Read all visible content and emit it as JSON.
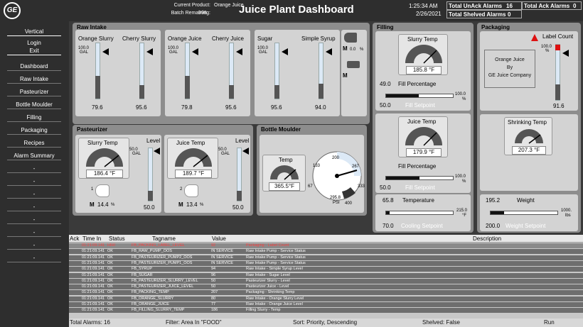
{
  "header": {
    "product_label": "Current Product:",
    "product_value": "Orange Juice",
    "batch_label": "Batch Remaining:",
    "batch_value": "998",
    "title": "Juice Plant Dashboard",
    "time": "1:25:34 AM",
    "date": "2/26/2021",
    "unack_label": "Total UnAck Alarms",
    "unack_value": "16",
    "ack_label": "Total Ack Alarms",
    "ack_value": "0",
    "shelved_label": "Total Shelved Alarms",
    "shelved_value": "0"
  },
  "sidebar": {
    "vertical": "Vertical",
    "login": "Login",
    "exit": "Exit",
    "items": [
      "Dashboard",
      "Raw Intake",
      "Pasteurizer",
      "Bottle Moulder",
      "Filling",
      "Packaging",
      "Recipes",
      "Alarm Summary",
      "-",
      "-",
      "-",
      "-",
      "-",
      "-",
      "-",
      "-"
    ]
  },
  "raw_intake": {
    "title": "Raw Intake",
    "tanks": [
      {
        "name": "Orange Slurry",
        "scale": "100.0",
        "unit": "GAL",
        "value": "79.6",
        "level": 0.8
      },
      {
        "name": "Cherry Slurry",
        "scale": "",
        "unit": "",
        "value": "95.6",
        "level": 0.96
      },
      {
        "name": "Orange Juice",
        "scale": "100.0",
        "unit": "GAL",
        "value": "79.8",
        "level": 0.8
      },
      {
        "name": "Cherry Juice",
        "scale": "",
        "unit": "",
        "value": "95.6",
        "level": 0.96
      },
      {
        "name": "Sugar",
        "scale": "100.0",
        "unit": "GAL",
        "value": "95.6",
        "level": 0.96
      },
      {
        "name": "Simple Syrup",
        "scale": "",
        "unit": "",
        "value": "94.0",
        "level": 0.94
      }
    ],
    "pump1": {
      "mode": "M",
      "value": "0.0",
      "unit": "%"
    },
    "pump2": {
      "mode": "M"
    }
  },
  "pasteurizer": {
    "title": "Pasteurizer",
    "units": [
      {
        "gauge": "Slurry Temp",
        "temp": "186.4 °F",
        "level_label": "Level",
        "scale": "50.0",
        "unit": "GAL",
        "level": "50.0",
        "pump": "1",
        "mode": "M",
        "pct": "14.4",
        "pct_unit": "%",
        "level_fill": 1.0
      },
      {
        "gauge": "Juice Temp",
        "temp": "189.7 °F",
        "level_label": "Level",
        "scale": "50.0",
        "unit": "GAL",
        "level": "50.0",
        "pump": "2",
        "mode": "M",
        "pct": "13.4",
        "pct_unit": "%",
        "level_fill": 1.0
      }
    ]
  },
  "bottle": {
    "title": "Bottle Moulder",
    "gauge": "Temp",
    "temp": "365.5°F",
    "dial": {
      "ticks": [
        "133",
        "200",
        "267",
        "333",
        "400",
        "67"
      ],
      "value": "295.8",
      "unit": "PSI"
    }
  },
  "filling": {
    "title": "Filling",
    "blocks": [
      {
        "gauge": "Slurry Temp",
        "temp": "185.8 °F",
        "min": "49.0",
        "label": "Fill Percentage",
        "max": "100.0",
        "max_unit": "%",
        "setpt_val": "50.0",
        "setpt": "Fill Setpoint",
        "fill": 0.49
      },
      {
        "gauge": "Juice Temp",
        "temp": "179.9 °F",
        "min": "",
        "label": "Fill Percentage",
        "max": "100.0",
        "max_unit": "%",
        "setpt_val": "50.0",
        "setpt": "Fill Setpoint",
        "fill": 0.5
      }
    ],
    "temp": {
      "min": "65.8",
      "label": "Temperature",
      "max": "215.0",
      "max_unit": "°F",
      "setpt_val": "70.0",
      "setpt": "Cooling Setpoint",
      "fill": 0.05
    }
  },
  "packaging": {
    "title": "Packaging",
    "product": "Orange Juice",
    "by": "By",
    "company": "GE Juice Company",
    "label_count": "Label Count",
    "lc_scale": "100.0",
    "lc_unit": "%",
    "lc_value": "91.6",
    "lc_level": 0.92,
    "shrink": "Shrinking Temp",
    "shrink_temp": "207.3 °F",
    "weight": {
      "min": "195.2",
      "label": "Weight",
      "max": "1000.",
      "max_unit": "lbs",
      "setpt_val": "200.0",
      "setpt": "Weight Setpoint",
      "fill": 0.2
    }
  },
  "alarms": {
    "headers": [
      "Ack",
      "Time In",
      "Status",
      "Tagname",
      "Value",
      "Description"
    ],
    "rows": [
      {
        "time": "01:21:09.141",
        "status": "HIHI",
        "tag": "FB_PACKING_LABEL_LEVEL",
        "value": "92",
        "desc": "Packaging - Label Count",
        "alarm": true
      },
      {
        "time": "01:21:09.141",
        "status": "OK",
        "tag": "FB_RAW_PUMP_OOS",
        "value": "IN SERVICE",
        "desc": "Raw Intake Pump - Service Status"
      },
      {
        "time": "01:21:09.141",
        "status": "OK",
        "tag": "FB_PASTEURIZER_PUMP2_OOS",
        "value": "IN SERVICE",
        "desc": "Raw Intake Pump - Service Status"
      },
      {
        "time": "01:21:09.141",
        "status": "OK",
        "tag": "FB_PASTEURIZER_PUMP1_OOS",
        "value": "IN SERVICE",
        "desc": "Raw Intake Pump - Service Status"
      },
      {
        "time": "01:21:09.141",
        "status": "OK",
        "tag": "FB_SYRUP",
        "value": "94",
        "desc": "Raw Intake - Simple Syrup Level"
      },
      {
        "time": "01:21:09.141",
        "status": "OK",
        "tag": "FB_SUGAR",
        "value": "96",
        "desc": "Raw Intake - Sugar Level"
      },
      {
        "time": "01:21:09.141",
        "status": "OK",
        "tag": "FB_PASTEURIZER_SLURRY_LEVEL",
        "value": "50",
        "desc": "Pasteurizer Slurry - Level"
      },
      {
        "time": "01:21:09.141",
        "status": "OK",
        "tag": "FB_PASTEURIZER_JUICE_LEVEL",
        "value": "50",
        "desc": "Pasteurizer Juice - Level"
      },
      {
        "time": "01:21:09.141",
        "status": "OK",
        "tag": "FB_PACKING_TEMP",
        "value": "207",
        "desc": "Packaging - Shrinking Temp"
      },
      {
        "time": "01:21:09.141",
        "status": "OK",
        "tag": "FB_ORANGE_SLURRY",
        "value": "80",
        "desc": "Raw Intake - Orange Slurry Level"
      },
      {
        "time": "01:21:09.141",
        "status": "OK",
        "tag": "FB_ORANGE_JUICE",
        "value": "77",
        "desc": "Raw Intake - Orange Juice Level"
      },
      {
        "time": "01:21:09.141",
        "status": "OK",
        "tag": "FB_FILLING_SLURRY_TEMP",
        "value": "186",
        "desc": "Filling Slurry - Temp"
      }
    ]
  },
  "status": {
    "total": "Total Alarms: 16",
    "filter": "Filter: Area In \"FOOD\"",
    "sort": "Sort: Priority, Descending",
    "shelved": "Shelved: False",
    "run": "Run"
  },
  "colors": {
    "alarm_row": "#b5121b",
    "ok_row": "#6e6e6e",
    "bg": "#3a3a3a"
  }
}
